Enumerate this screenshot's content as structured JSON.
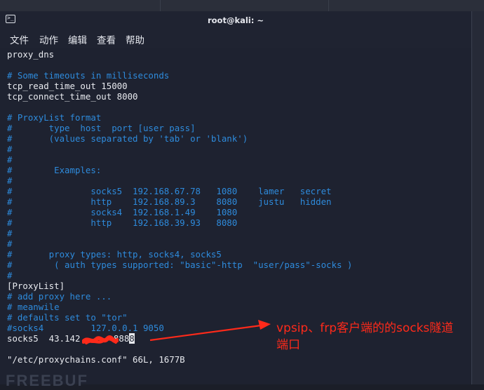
{
  "window": {
    "title": "root@kali: ~"
  },
  "menu": [
    "文件",
    "动作",
    "编辑",
    "查看",
    "帮助"
  ],
  "lines": [
    {
      "text": "proxy_dns",
      "style": "plain"
    },
    {
      "text": "",
      "style": "plain"
    },
    {
      "text": "# Some timeouts in milliseconds",
      "style": "comment"
    },
    {
      "text": "tcp_read_time_out 15000",
      "style": "plain"
    },
    {
      "text": "tcp_connect_time_out 8000",
      "style": "plain"
    },
    {
      "text": "",
      "style": "plain"
    },
    {
      "text": "# ProxyList format",
      "style": "comment"
    },
    {
      "text": "#       type  host  port [user pass]",
      "style": "comment"
    },
    {
      "text": "#       (values separated by 'tab' or 'blank')",
      "style": "comment"
    },
    {
      "text": "#",
      "style": "comment"
    },
    {
      "text": "#",
      "style": "comment"
    },
    {
      "text": "#        Examples:",
      "style": "comment"
    },
    {
      "text": "#",
      "style": "comment"
    },
    {
      "text": "#               socks5  192.168.67.78   1080    lamer   secret",
      "style": "comment"
    },
    {
      "text": "#               http    192.168.89.3    8080    justu   hidden",
      "style": "comment"
    },
    {
      "text": "#               socks4  192.168.1.49    1080",
      "style": "comment"
    },
    {
      "text": "#               http    192.168.39.93   8080",
      "style": "comment"
    },
    {
      "text": "#",
      "style": "comment"
    },
    {
      "text": "#",
      "style": "comment"
    },
    {
      "text": "#       proxy types: http, socks4, socks5",
      "style": "comment"
    },
    {
      "text": "#        ( auth types supported: \"basic\"-http  \"user/pass\"-socks )",
      "style": "comment"
    },
    {
      "text": "#",
      "style": "comment"
    },
    {
      "text": "[ProxyList]",
      "style": "plain"
    },
    {
      "text": "# add proxy here ...",
      "style": "comment"
    },
    {
      "text": "# meanwile",
      "style": "comment"
    },
    {
      "text": "# defaults set to \"tor\"",
      "style": "comment"
    },
    {
      "text": "#socks4         127.0.0.1 9050",
      "style": "comment"
    }
  ],
  "edit_line": {
    "prefix": "socks5  43.142.",
    "port_visible": "888",
    "port_cursor_char": "8"
  },
  "status_line": "\"/etc/proxychains.conf\" 66L, 1677B",
  "annotation": {
    "text": "vpsip、frp客户端的的socks隧道\n端口",
    "color": "#ff2a1a"
  },
  "watermark": "FREEBUF"
}
